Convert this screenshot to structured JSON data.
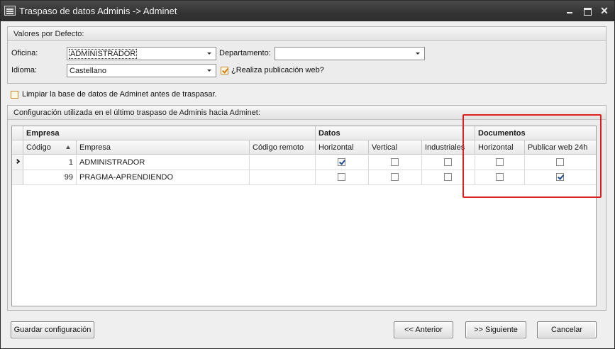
{
  "window": {
    "title": "Traspaso de datos Adminis -> Adminet",
    "controls": [
      "minimize-icon",
      "maximize-icon",
      "close-icon"
    ]
  },
  "defaults": {
    "header": "Valores por Defecto:",
    "oficina_label": "Oficina:",
    "oficina_value": "ADMINISTRADOR",
    "departamento_label": "Departamento:",
    "departamento_value": "",
    "idioma_label": "Idioma:",
    "idioma_value": "Castellano",
    "publicacion_label": "¿Realiza publicación web?",
    "publicacion_checked": true
  },
  "limpiar": {
    "label": "Limpiar la base de datos de Adminet antes de traspasar.",
    "checked": false
  },
  "config": {
    "header": "Configuración utilizada en el último traspaso de Adminis hacia Adminet:",
    "bands": [
      "Empresa",
      "Datos",
      "Documentos"
    ],
    "columns": [
      "Código",
      "Empresa",
      "Código remoto",
      "Horizontal",
      "Vertical",
      "Industriales",
      "Horizontal",
      "Publicar web 24h"
    ],
    "rows": [
      {
        "codigo": "1",
        "empresa": "ADMINISTRADOR",
        "remoto": "",
        "datos_horizontal": true,
        "datos_vertical": false,
        "datos_industriales": false,
        "doc_horizontal": false,
        "doc_publicar": false,
        "current": true
      },
      {
        "codigo": "99",
        "empresa": "PRAGMA-APRENDIENDO",
        "remoto": "",
        "datos_horizontal": false,
        "datos_vertical": false,
        "datos_industriales": false,
        "doc_horizontal": false,
        "doc_publicar": true,
        "current": false
      }
    ]
  },
  "buttons": {
    "guardar": "Guardar configuración",
    "anterior": "<< Anterior",
    "siguiente": ">> Siguiente",
    "cancelar": "Cancelar"
  },
  "colors": {
    "titlebar": "#333333",
    "highlight": "#e02020",
    "check": "#1e4b8f"
  }
}
